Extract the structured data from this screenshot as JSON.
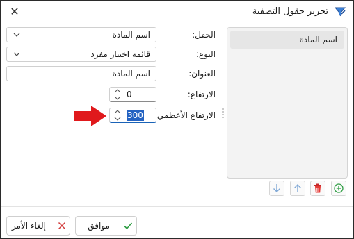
{
  "window": {
    "title": "تحرير حقول التصفية",
    "close_symbol": "✕"
  },
  "list": {
    "items": [
      "اسم المادة"
    ]
  },
  "form": {
    "field": {
      "label": "الحقل:",
      "value": "اسم المادة"
    },
    "type": {
      "label": "النوع:",
      "value": "قائمة اختيار مفرد"
    },
    "caption": {
      "label": "العنوان:",
      "value": "اسم المادة"
    },
    "height": {
      "label": "الارتفاع:",
      "value": "0"
    },
    "max_height": {
      "label": "الارتفاع الأعظمي:",
      "value": "300"
    }
  },
  "toolbar": {
    "icons": [
      "arrow-down-icon",
      "arrow-up-icon",
      "trash-icon",
      "add-circle-icon"
    ]
  },
  "footer": {
    "cancel_label": "إلغاء الأمر",
    "ok_label": "موافق"
  },
  "colors": {
    "accent": "#1a63b7",
    "selection": "#2463c2",
    "arrow": "#e0191c",
    "ok_check": "#2f9e44",
    "cancel_x": "#d23b3b"
  }
}
